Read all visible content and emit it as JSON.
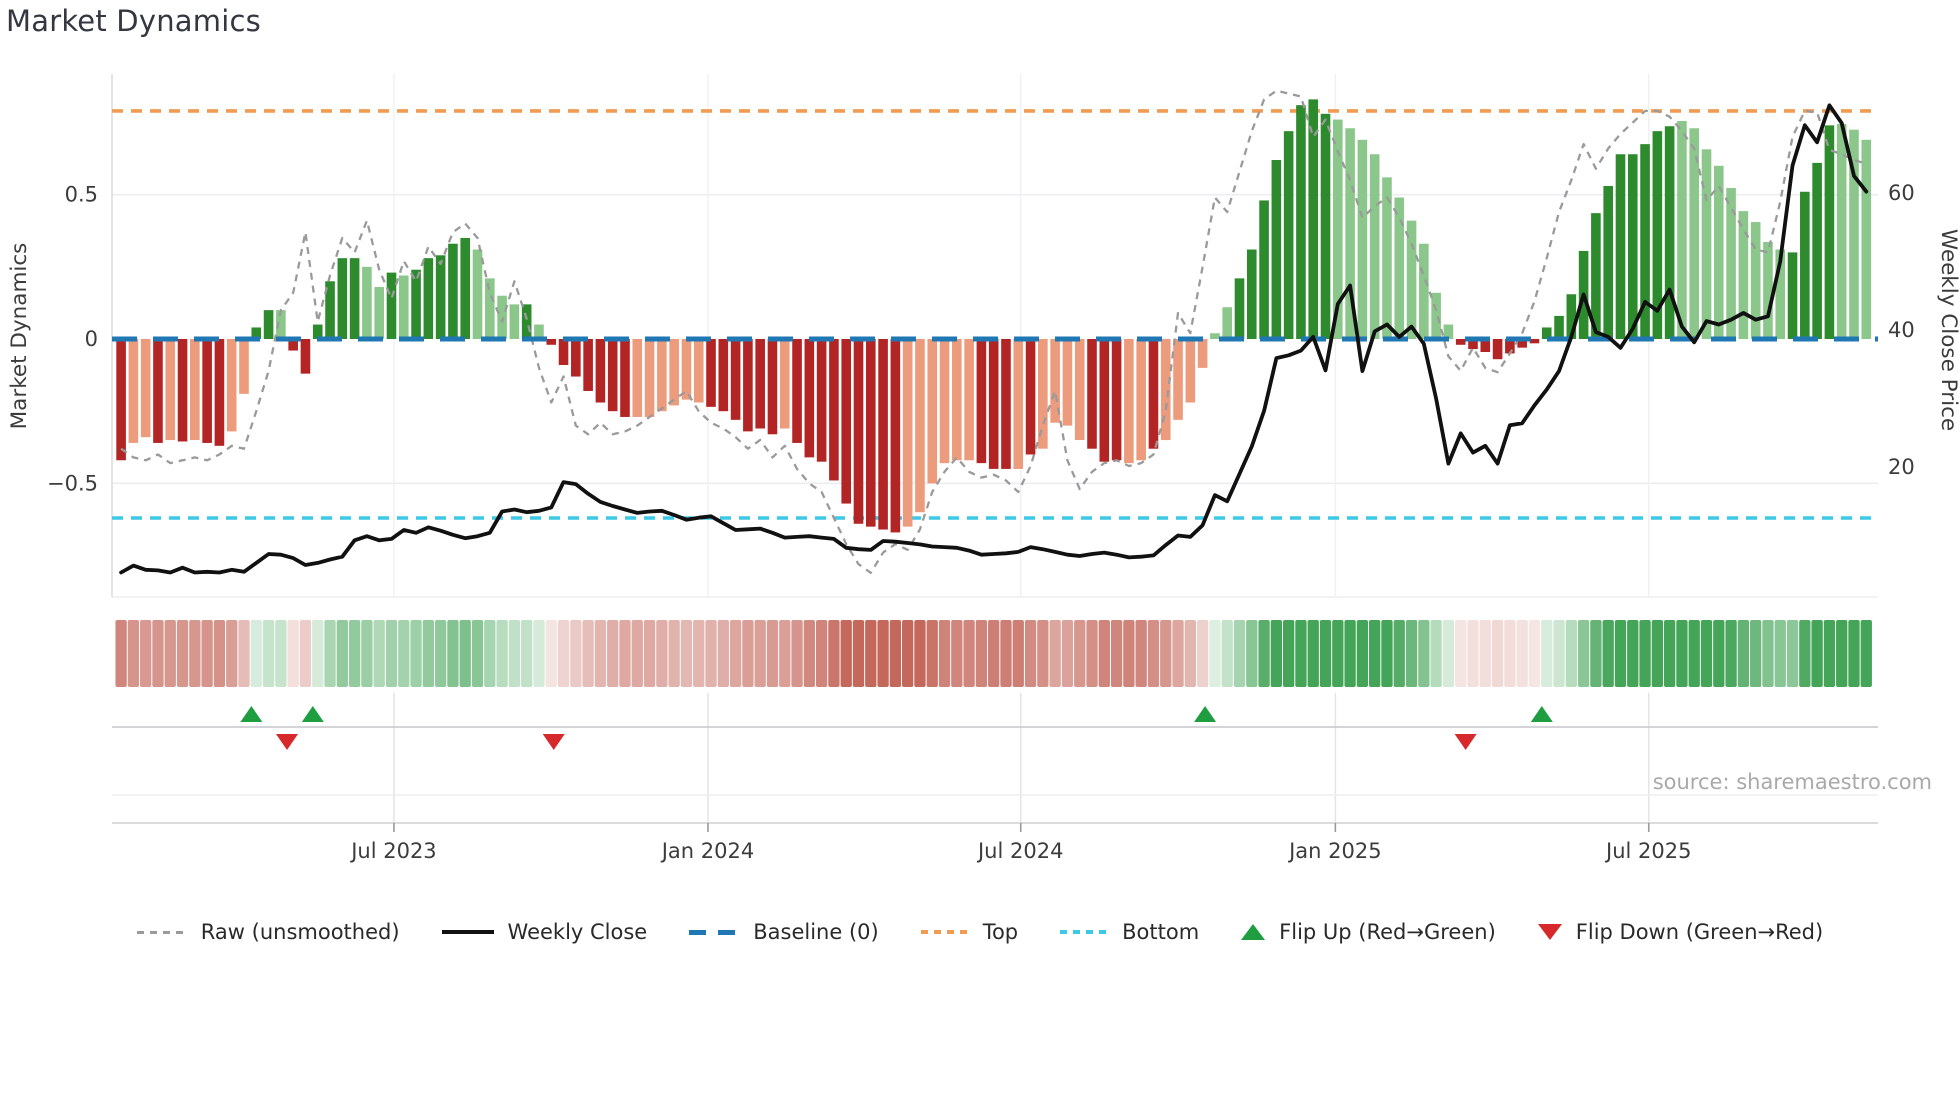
{
  "title": "Market Dynamics",
  "source": "source: sharemaestro.com",
  "legend": {
    "raw": "Raw (unsmoothed)",
    "close": "Weekly Close",
    "baseline": "Baseline (0)",
    "top": "Top",
    "bottom": "Bottom",
    "flip_up": "Flip Up (Red→Green)",
    "flip_down": "Flip Down (Green→Red)"
  },
  "colors": {
    "bar_dark_red": "#b32424",
    "bar_light_red": "#ec9b7d",
    "bar_dark_green": "#2e8b2d",
    "bar_light_green": "#8bc78b",
    "baseline": "#1f77b4",
    "top_line": "#f19c52",
    "bottom_line": "#3cc8e6",
    "raw_line": "#9a9a9a",
    "price_line": "#111111",
    "flip_up": "#1f9e41",
    "flip_down": "#d7282c",
    "heat_pos": "#44a458",
    "heat_neg": "#c4685c",
    "grid": "#ededf1",
    "tick_text": "#3c3c3c",
    "source_text": "#a9a9a9"
  },
  "chart_data": {
    "type": "bar",
    "subtype": "oscillator-combo",
    "title": "Market Dynamics",
    "left_axis": {
      "label": "Market Dynamics",
      "ticks": [
        0.5,
        0,
        -0.5
      ],
      "tick_labels": [
        "0.5",
        "0",
        "−0.5"
      ],
      "range": [
        -0.9,
        0.92
      ]
    },
    "right_axis": {
      "label": "Weekly Close Price",
      "ticks": [
        60,
        40,
        20
      ],
      "tick_labels": [
        "60",
        "40",
        "20"
      ],
      "range": [
        1,
        78
      ]
    },
    "x_ticks": [
      {
        "label": "Jul 2023",
        "week": 22.2
      },
      {
        "label": "Jan 2024",
        "week": 47.75
      },
      {
        "label": "Jul 2024",
        "week": 73.2
      },
      {
        "label": "Jan 2025",
        "week": 98.8
      },
      {
        "label": "Jul 2025",
        "week": 124.3
      }
    ],
    "baseline": 0,
    "top_level": 0.79,
    "bottom_level": -0.62,
    "weeks": 143,
    "bar_values": [
      -0.42,
      -0.36,
      -0.34,
      -0.36,
      -0.35,
      -0.355,
      -0.35,
      -0.36,
      -0.37,
      -0.32,
      -0.19,
      0.04,
      0.1,
      0.1,
      -0.04,
      -0.12,
      0.05,
      0.2,
      0.28,
      0.28,
      0.25,
      0.18,
      0.23,
      0.22,
      0.24,
      0.28,
      0.29,
      0.33,
      0.35,
      0.31,
      0.21,
      0.15,
      0.12,
      0.12,
      0.05,
      -0.02,
      -0.09,
      -0.13,
      -0.18,
      -0.22,
      -0.25,
      -0.27,
      -0.27,
      -0.27,
      -0.25,
      -0.23,
      -0.21,
      -0.22,
      -0.235,
      -0.25,
      -0.28,
      -0.32,
      -0.31,
      -0.33,
      -0.31,
      -0.36,
      -0.41,
      -0.425,
      -0.49,
      -0.57,
      -0.64,
      -0.65,
      -0.66,
      -0.67,
      -0.65,
      -0.6,
      -0.5,
      -0.43,
      -0.42,
      -0.42,
      -0.43,
      -0.45,
      -0.45,
      -0.45,
      -0.4,
      -0.38,
      -0.29,
      -0.3,
      -0.35,
      -0.38,
      -0.425,
      -0.42,
      -0.43,
      -0.42,
      -0.38,
      -0.35,
      -0.28,
      -0.22,
      -0.1,
      0.02,
      0.11,
      0.21,
      0.31,
      0.48,
      0.62,
      0.72,
      0.81,
      0.83,
      0.78,
      0.76,
      0.73,
      0.69,
      0.64,
      0.56,
      0.49,
      0.41,
      0.33,
      0.16,
      0.05,
      -0.02,
      -0.035,
      -0.045,
      -0.07,
      -0.05,
      -0.03,
      -0.015,
      0.04,
      0.08,
      0.155,
      0.305,
      0.436,
      0.53,
      0.64,
      0.64,
      0.675,
      0.72,
      0.737,
      0.755,
      0.73,
      0.657,
      0.6,
      0.523,
      0.443,
      0.405,
      0.336,
      0.31,
      0.3,
      0.51,
      0.61,
      0.74,
      0.745,
      0.725,
      0.69
    ],
    "bar_shade": "dlldldlddllddlddddddlldldddddlllldldddddddllllllddddddldddddddddlllllldddldlllldddlldllllllddddddddllllllllllddddddddddddddddddlllllllllddddll",
    "raw_values": [
      -0.38,
      -0.41,
      -0.42,
      -0.4,
      -0.43,
      -0.42,
      -0.41,
      -0.42,
      -0.4,
      -0.37,
      -0.38,
      -0.25,
      -0.11,
      0.1,
      0.16,
      0.37,
      0.06,
      0.22,
      0.35,
      0.3,
      0.41,
      0.24,
      0.14,
      0.27,
      0.2,
      0.32,
      0.26,
      0.37,
      0.4,
      0.35,
      0.16,
      0.06,
      0.2,
      0.07,
      -0.1,
      -0.22,
      -0.13,
      -0.3,
      -0.33,
      -0.29,
      -0.33,
      -0.32,
      -0.3,
      -0.27,
      -0.24,
      -0.21,
      -0.18,
      -0.25,
      -0.29,
      -0.31,
      -0.34,
      -0.38,
      -0.35,
      -0.41,
      -0.37,
      -0.45,
      -0.5,
      -0.53,
      -0.62,
      -0.71,
      -0.78,
      -0.81,
      -0.74,
      -0.71,
      -0.73,
      -0.66,
      -0.53,
      -0.46,
      -0.41,
      -0.46,
      -0.48,
      -0.47,
      -0.49,
      -0.53,
      -0.44,
      -0.3,
      -0.18,
      -0.42,
      -0.52,
      -0.46,
      -0.43,
      -0.42,
      -0.44,
      -0.43,
      -0.4,
      -0.25,
      0.09,
      0.02,
      0.25,
      0.49,
      0.44,
      0.58,
      0.72,
      0.83,
      0.86,
      0.85,
      0.84,
      0.7,
      0.76,
      0.65,
      0.55,
      0.42,
      0.46,
      0.49,
      0.42,
      0.33,
      0.22,
      0.1,
      -0.06,
      -0.11,
      -0.03,
      -0.1,
      -0.115,
      -0.05,
      0.02,
      0.13,
      0.28,
      0.44,
      0.55,
      0.675,
      0.59,
      0.66,
      0.71,
      0.75,
      0.79,
      0.79,
      0.77,
      0.72,
      0.66,
      0.48,
      0.53,
      0.455,
      0.38,
      0.31,
      0.3,
      0.475,
      0.7,
      0.79,
      0.785,
      0.655,
      0.64,
      0.62,
      0.607
    ],
    "price_values": [
      4.6,
      5.6,
      5.0,
      4.9,
      4.6,
      5.3,
      4.6,
      4.7,
      4.6,
      5.0,
      4.7,
      6.0,
      7.3,
      7.2,
      6.7,
      5.7,
      6.0,
      6.5,
      6.9,
      9.3,
      9.9,
      9.3,
      9.5,
      10.8,
      10.4,
      11.2,
      10.7,
      10.1,
      9.6,
      9.9,
      10.4,
      13.5,
      13.8,
      13.4,
      13.6,
      14.1,
      17.8,
      17.5,
      16.1,
      14.9,
      14.3,
      13.8,
      13.3,
      13.5,
      13.6,
      13.0,
      12.3,
      12.6,
      12.8,
      11.8,
      10.8,
      10.9,
      11.0,
      10.4,
      9.7,
      9.8,
      9.9,
      9.7,
      9.5,
      8.2,
      8.0,
      7.9,
      9.2,
      9.1,
      8.9,
      8.7,
      8.4,
      8.3,
      8.2,
      7.8,
      7.2,
      7.3,
      7.4,
      7.6,
      8.3,
      8.0,
      7.6,
      7.2,
      7.0,
      7.3,
      7.5,
      7.2,
      6.8,
      6.9,
      7.1,
      8.6,
      10.0,
      9.8,
      11.5,
      15.9,
      15.0,
      19.0,
      23.0,
      28.2,
      35.9,
      36.3,
      37.0,
      39.0,
      34.1,
      43.8,
      46.5,
      34.0,
      39.8,
      40.8,
      39.0,
      40.5,
      38.0,
      30.0,
      20.5,
      24.9,
      22.1,
      23.1,
      20.5,
      26.1,
      26.4,
      29.0,
      31.3,
      34.0,
      39.0,
      45.2,
      39.7,
      39.0,
      37.4,
      40.2,
      44.1,
      42.8,
      45.9,
      40.5,
      38.2,
      41.3,
      40.8,
      41.5,
      42.5,
      41.5,
      42.0,
      50.0,
      64.0,
      69.9,
      67.4,
      72.8,
      70.2,
      62.5,
      60.2
    ],
    "flip_up_weeks": [
      10.6,
      15.6,
      88.2,
      115.6
    ],
    "flip_down_weeks": [
      13.5,
      35.2,
      109.4
    ],
    "legend_entries": [
      "Raw (unsmoothed)",
      "Weekly Close",
      "Baseline (0)",
      "Top",
      "Bottom",
      "Flip Up (Red→Green)",
      "Flip Down (Green→Red)"
    ]
  }
}
